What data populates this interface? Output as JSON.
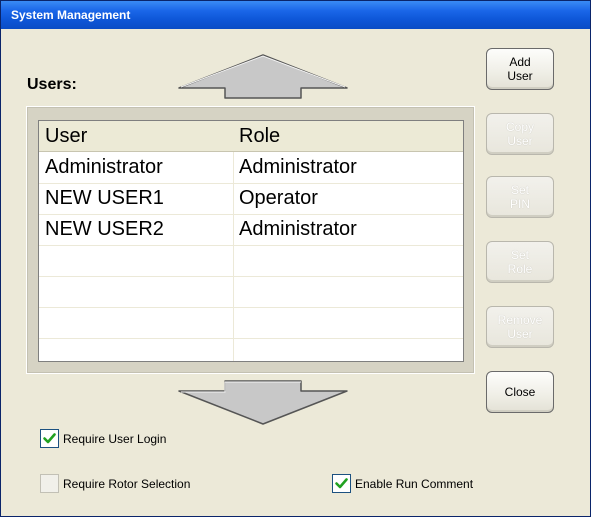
{
  "window": {
    "title": "System Management",
    "title_bar_color": "#0a4cc5"
  },
  "users_label": "Users:",
  "table": {
    "headers": [
      "User",
      "Role"
    ],
    "rows": [
      {
        "user": "Administrator",
        "role": "Administrator"
      },
      {
        "user": "NEW USER1",
        "role": "Operator"
      },
      {
        "user": "NEW USER2",
        "role": "Administrator"
      },
      {
        "user": "",
        "role": ""
      },
      {
        "user": "",
        "role": ""
      },
      {
        "user": "",
        "role": ""
      },
      {
        "user": "",
        "role": ""
      }
    ]
  },
  "buttons": {
    "add_user": "Add\nUser",
    "copy_user": "Copy\nUser",
    "set_pin": "Set\nPIN",
    "set_role": "Set\nRole",
    "remove_user": "Remove\nUser",
    "close": "Close"
  },
  "checkboxes": {
    "require_user_login": {
      "label": "Require User Login",
      "checked": true
    },
    "require_rotor_selection": {
      "label": "Require Rotor Selection",
      "checked": false
    },
    "enable_run_comment": {
      "label": "Enable Run Comment",
      "checked": true
    }
  },
  "icons": {
    "scroll_up": "up-arrow-icon",
    "scroll_down": "down-arrow-icon",
    "check": "checkmark-icon"
  },
  "colors": {
    "checkmark": "#21a121",
    "arrow_fill": "#c8c8c8",
    "header_bg": "#ecead6"
  }
}
